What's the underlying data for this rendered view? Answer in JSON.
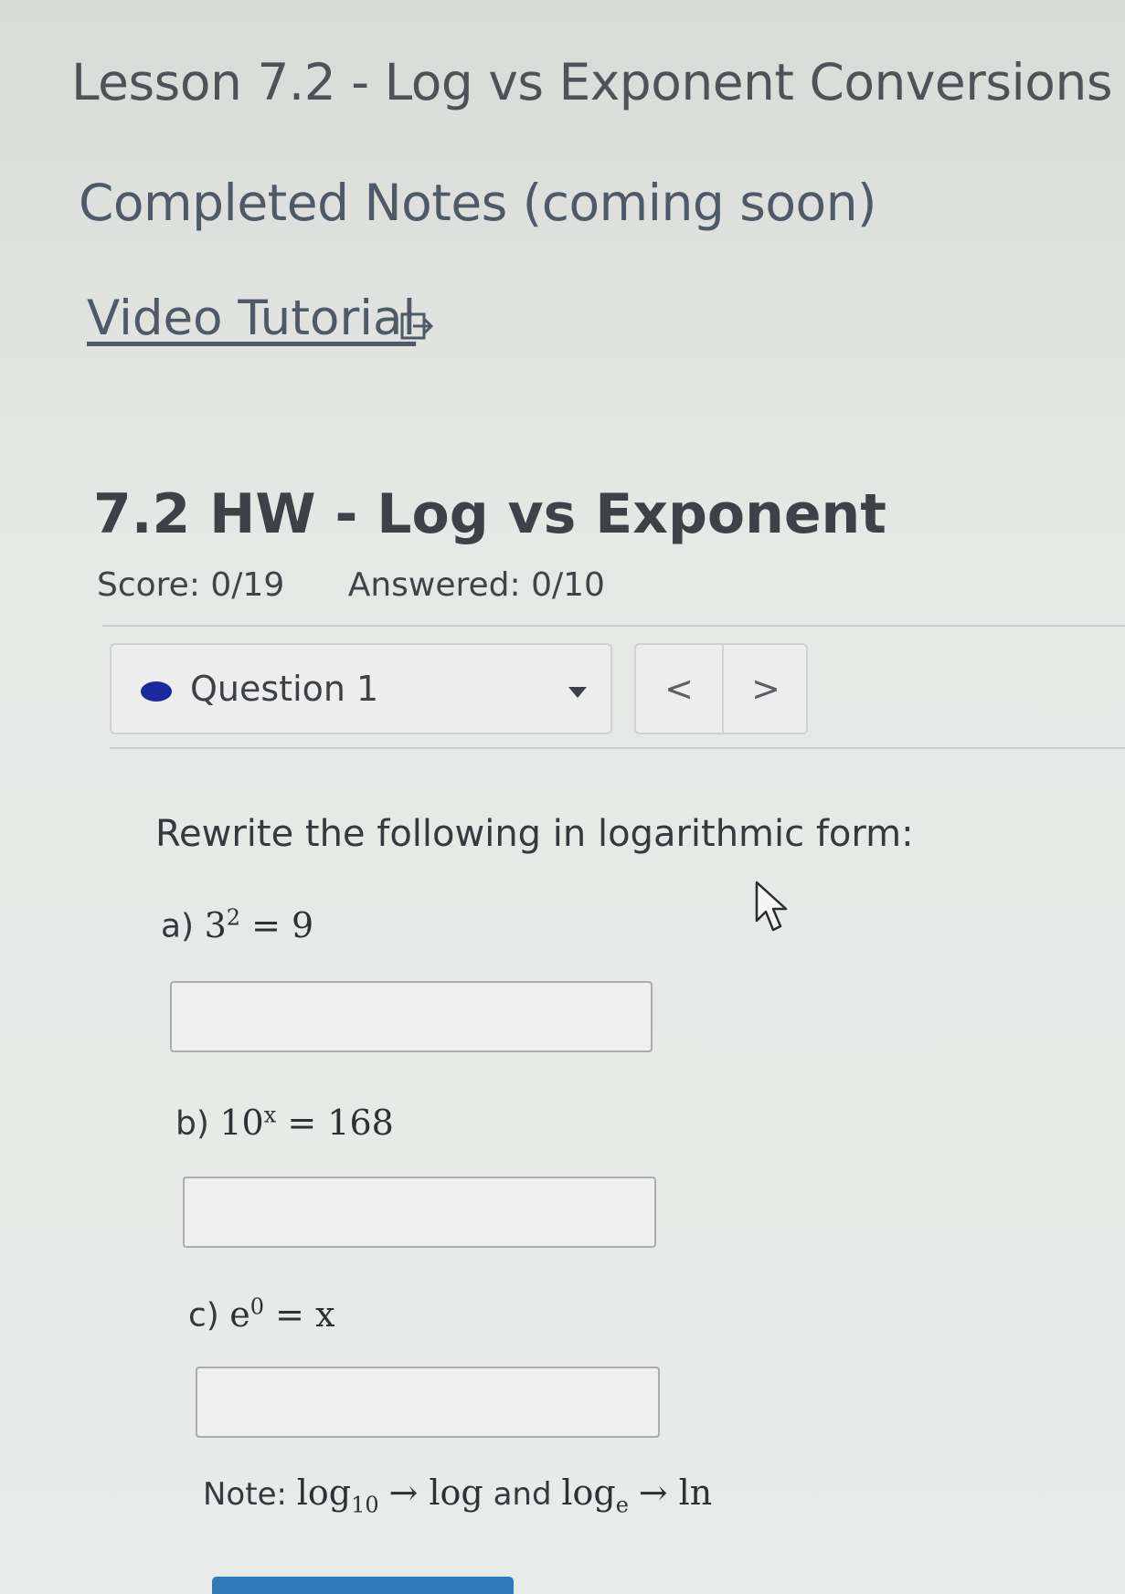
{
  "lesson": {
    "title": "Lesson 7.2 - Log vs Exponent Conversions",
    "notes_link": "Completed Notes (coming soon)",
    "video_link": "Video Tutorial"
  },
  "assignment": {
    "title": "7.2 HW - Log vs Exponent",
    "score": "Score: 0/19",
    "answered": "Answered: 0/10"
  },
  "question_nav": {
    "selected": "Question 1",
    "prev": "<",
    "next": ">"
  },
  "question": {
    "prompt": "Rewrite the following in logarithmic form:",
    "parts": [
      {
        "label": "a)",
        "base": "3",
        "exp": "2",
        "rhs": "= 9",
        "answer": ""
      },
      {
        "label": "b)",
        "base": "10",
        "exp": "x",
        "rhs": "= 168",
        "answer": ""
      },
      {
        "label": "c)",
        "base": "e",
        "exp": "0",
        "rhs": "= x",
        "answer": ""
      }
    ],
    "note": {
      "prefix": "Note:",
      "log10": "log",
      "log10_sub": "10",
      "arrow1": "→ log",
      "and": "and",
      "loge": "log",
      "loge_sub": "e",
      "arrow2": "→ ln"
    }
  },
  "colors": {
    "accent_dot": "#1a2a9e",
    "submit_button": "#2f7ab8"
  },
  "icons": [
    "external-link-icon",
    "dropdown-caret-icon",
    "mouse-cursor-icon"
  ]
}
